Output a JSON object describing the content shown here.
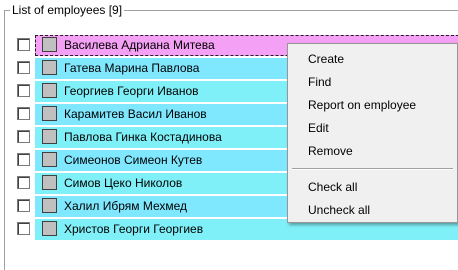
{
  "group": {
    "title": "List of employees [9]"
  },
  "employees": [
    {
      "name": "Василева Адриана Митева"
    },
    {
      "name": "Гатева Марина Павлова"
    },
    {
      "name": "Георгиев Георги Иванов"
    },
    {
      "name": "Карамитев Васил Иванов"
    },
    {
      "name": "Павлова Гинка Костадинова"
    },
    {
      "name": "Симеонов Симеон Кутев"
    },
    {
      "name": "Симов Цеко Николов"
    },
    {
      "name": "Халил Ибрям Мехмед"
    },
    {
      "name": "Христов Георги Георгиев"
    }
  ],
  "context_menu": {
    "create": "Create",
    "find": "Find",
    "report": "Report on employee",
    "edit": "Edit",
    "remove": "Remove",
    "check_all": "Check all",
    "uncheck_all": "Uncheck all"
  },
  "colors": {
    "row_band": "#7fe8ff",
    "selected_band": "#f4a0f4",
    "menu_background": "#f0f0f0"
  }
}
